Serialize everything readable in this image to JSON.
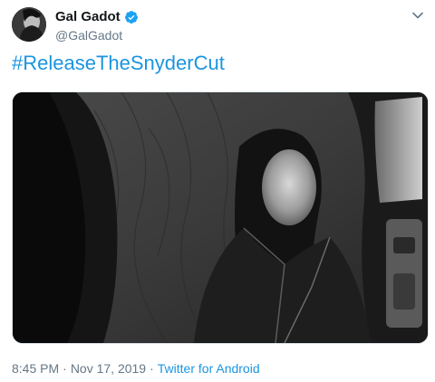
{
  "tweet": {
    "author": {
      "display_name": "Gal Gadot",
      "handle": "@GalGadot",
      "verified": true,
      "verified_color": "#1da1f2"
    },
    "text": "#ReleaseTheSnyderCut",
    "media": {
      "type": "photo",
      "style": "black-and-white"
    },
    "meta": {
      "time": "8:45 PM",
      "date": "Nov 17, 2019",
      "separator": "·",
      "source": "Twitter for Android"
    },
    "menu_icon": "chevron-down-icon"
  },
  "colors": {
    "link": "#1b95e0",
    "secondary_text": "#657786",
    "primary_text": "#14171a"
  }
}
